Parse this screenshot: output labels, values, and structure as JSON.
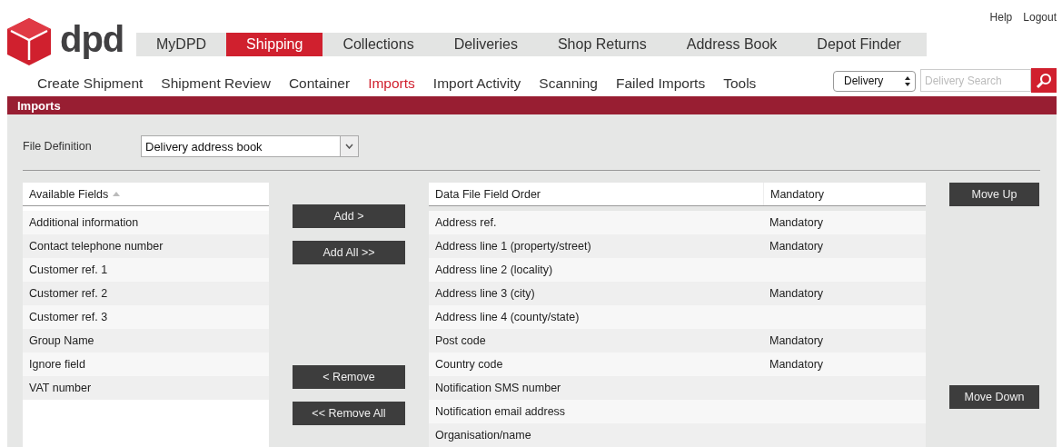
{
  "header": {
    "logo_text": "dpd",
    "links": [
      "Help",
      "Logout"
    ]
  },
  "main_nav": [
    {
      "label": "MyDPD",
      "selected": false
    },
    {
      "label": "Shipping",
      "selected": true
    },
    {
      "label": "Collections",
      "selected": false
    },
    {
      "label": "Deliveries",
      "selected": false
    },
    {
      "label": "Shop Returns",
      "selected": false
    },
    {
      "label": "Address Book",
      "selected": false
    },
    {
      "label": "Depot Finder",
      "selected": false
    }
  ],
  "sub_nav": [
    {
      "label": "Create Shipment",
      "selected": false
    },
    {
      "label": "Shipment Review",
      "selected": false
    },
    {
      "label": "Container",
      "selected": false
    },
    {
      "label": "Imports",
      "selected": true
    },
    {
      "label": "Import Activity",
      "selected": false
    },
    {
      "label": "Scanning",
      "selected": false
    },
    {
      "label": "Failed Imports",
      "selected": false
    },
    {
      "label": "Tools",
      "selected": false
    }
  ],
  "search": {
    "scope": "Delivery",
    "placeholder": "Delivery Search"
  },
  "section_title": "Imports",
  "file_definition": {
    "label": "File Definition",
    "value": "Delivery address book"
  },
  "available_fields": {
    "header": "Available Fields",
    "rows": [
      "Additional information",
      "Contact telephone number",
      "Customer ref. 1",
      "Customer ref. 2",
      "Customer ref. 3",
      "Group Name",
      "Ignore field",
      "VAT number"
    ]
  },
  "transfer_buttons": [
    "Add >",
    "Add All >>",
    "< Remove",
    "<< Remove All"
  ],
  "field_order": {
    "columns": [
      "Data File Field Order",
      "Mandatory"
    ],
    "rows": [
      {
        "field": "Address ref.",
        "mandatory": "Mandatory"
      },
      {
        "field": "Address line 1 (property/street)",
        "mandatory": "Mandatory"
      },
      {
        "field": "Address line 2 (locality)"
      },
      {
        "field": "Address line 3 (city)",
        "mandatory": "Mandatory"
      },
      {
        "field": "Address line 4 (county/state)"
      },
      {
        "field": "Post code",
        "mandatory": "Mandatory"
      },
      {
        "field": "Country code",
        "mandatory": "Mandatory"
      },
      {
        "field": "Notification SMS number"
      },
      {
        "field": "Notification email address"
      },
      {
        "field": "Organisation/name"
      }
    ]
  },
  "move_buttons": [
    "Move Up",
    "Move Down"
  ]
}
